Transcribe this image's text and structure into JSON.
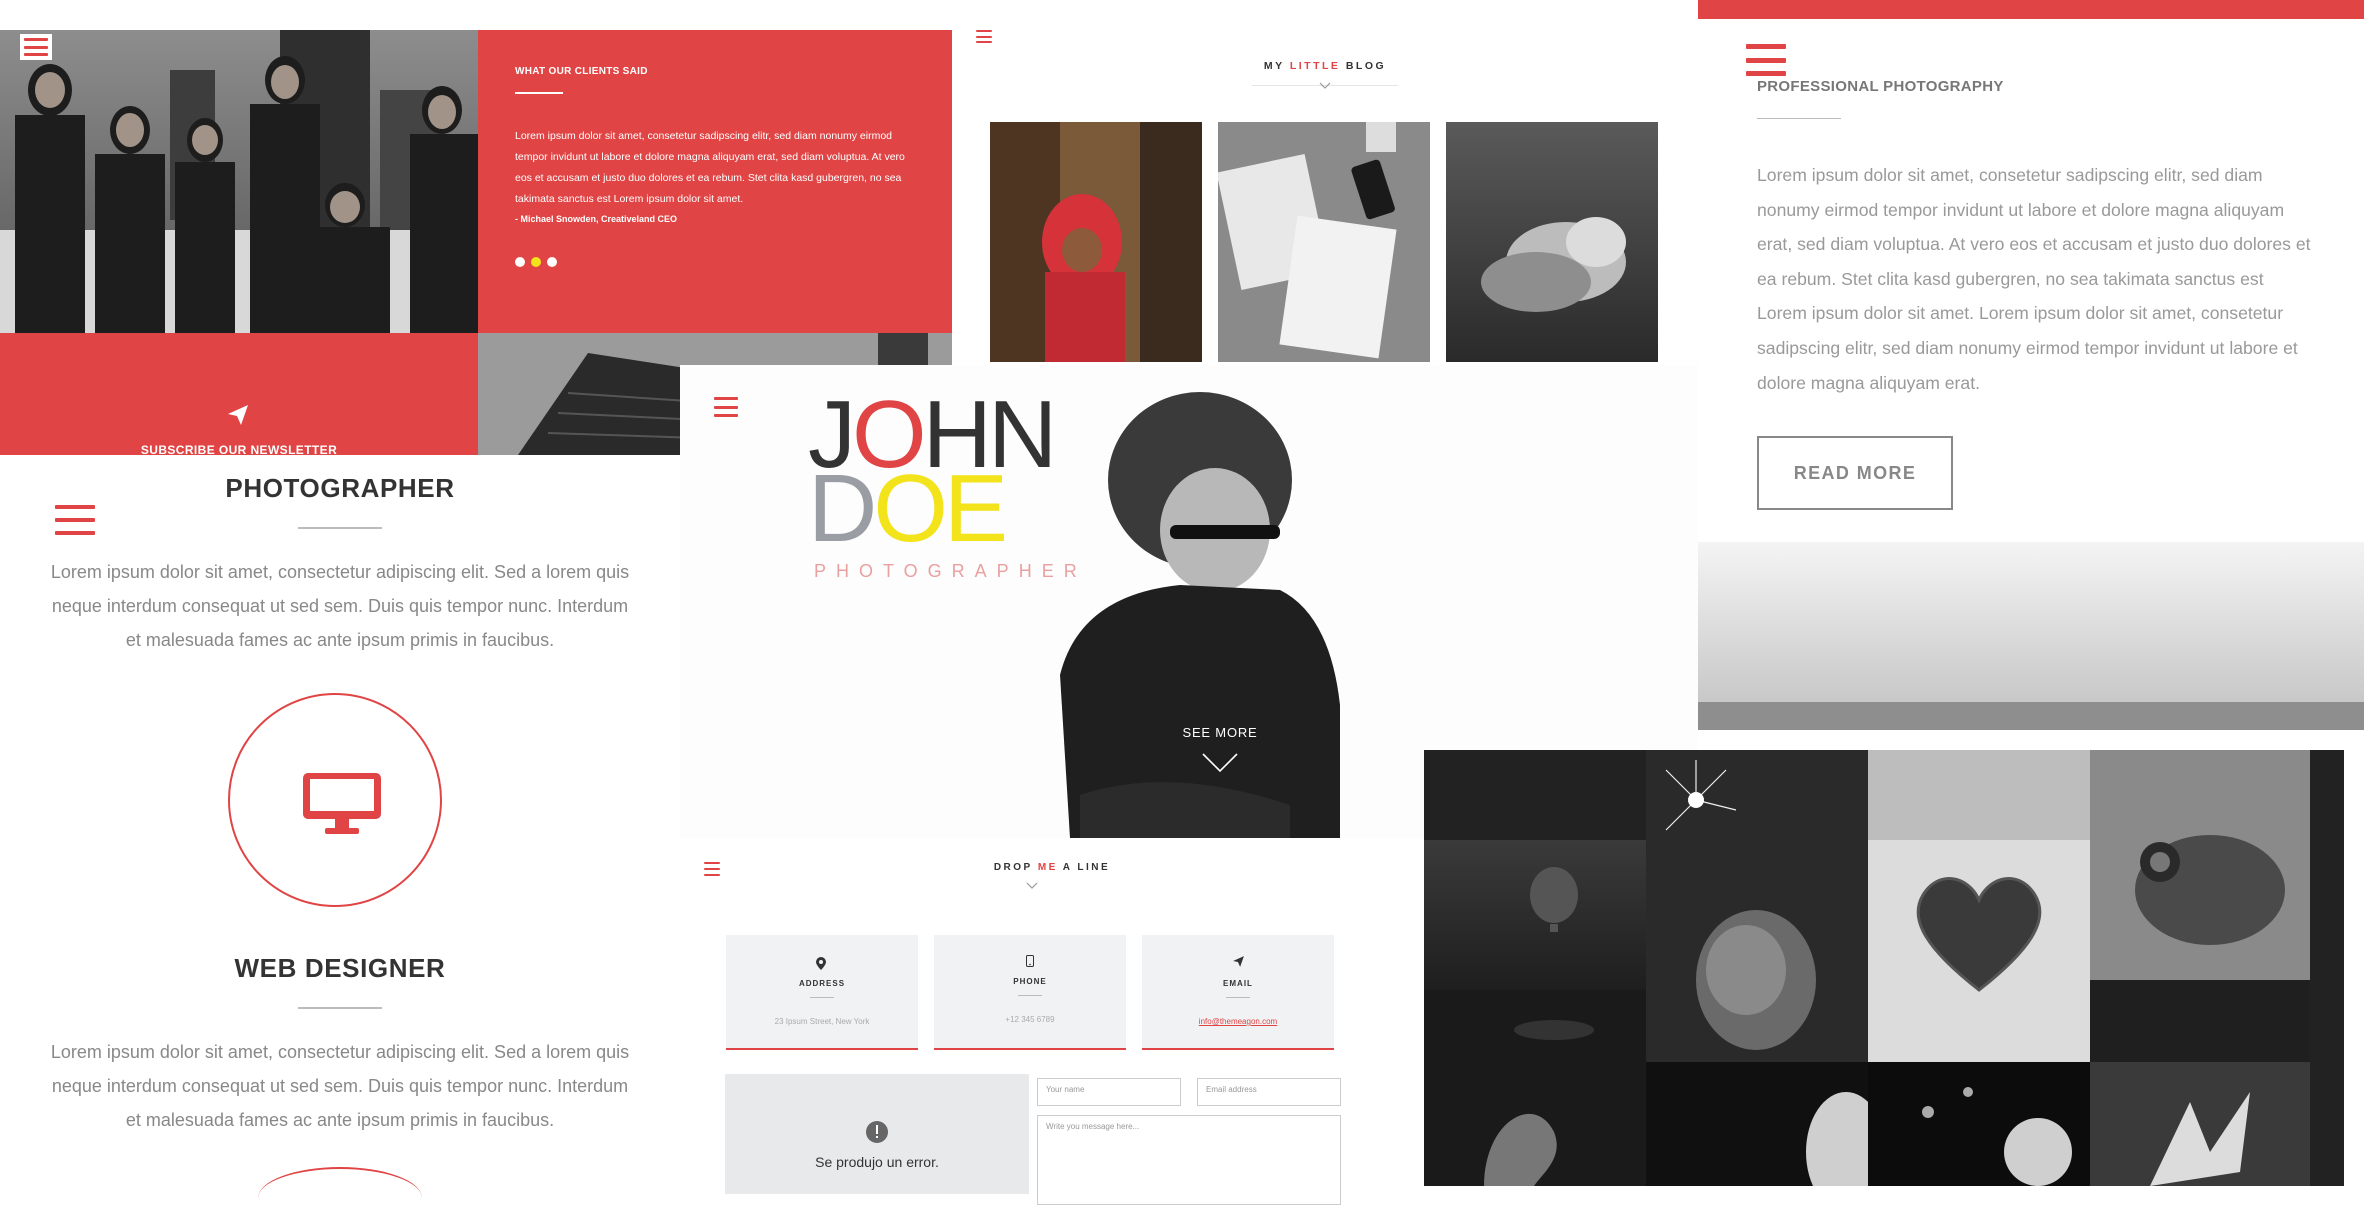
{
  "testimonial": {
    "title": "WHAT OUR CLIENTS SAID",
    "text": "Lorem ipsum dolor sit amet, consetetur sadipscing elitr, sed diam nonumy eirmod tempor invidunt ut labore et dolore magna aliquyam erat, sed diam voluptua. At vero eos et accusam et justo duo dolores et ea rebum. Stet clita kasd gubergren, no sea takimata sanctus est Lorem ipsum dolor sit amet.",
    "author": "- Michael Snowden, Creativeland CEO",
    "newsletter_label": "SUBSCRIBE OUR NEWSLETTER",
    "active_dot": 2
  },
  "blog": {
    "title_pre": "MY ",
    "title_accent": "LITTLE",
    "title_post": " BLOG"
  },
  "pro": {
    "title": "PROFESSIONAL PHOTOGRAPHY",
    "text": "Lorem ipsum dolor sit amet, consetetur sadipscing elitr, sed diam nonumy eirmod tempor invidunt ut labore et dolore magna aliquyam erat, sed diam voluptua. At vero eos et accusam et justo duo dolores et ea rebum. Stet clita kasd gubergren, no sea takimata sanctus est Lorem ipsum dolor sit amet. Lorem ipsum dolor sit amet, consetetur sadipscing elitr, sed diam nonumy eirmod tempor invidunt ut labore et dolore magna aliquyam erat.",
    "button": "READ MORE"
  },
  "roles": [
    {
      "title": "PHOTOGRAPHER",
      "text": "Lorem ipsum dolor sit amet, consectetur adipiscing elit. Sed a lorem quis neque interdum consequat ut sed sem. Duis quis tempor nunc. Interdum et malesuada fames ac ante ipsum primis in faucibus."
    },
    {
      "title": "WEB DESIGNER",
      "text": "Lorem ipsum dolor sit amet, consectetur adipiscing elit. Sed a lorem quis neque interdum consequat ut sed sem. Duis quis tempor nunc. Interdum et malesuada fames ac ante ipsum primis in faucibus."
    }
  ],
  "hero": {
    "name_a1": "J",
    "name_a2": "O",
    "name_a3": "HN",
    "name_b1": "D",
    "name_b2": "OE",
    "subtitle": "PHOTOGRAPHER",
    "see_more": "SEE MORE"
  },
  "contact": {
    "title_pre": "DROP ",
    "title_accent": "ME",
    "title_post": " A LINE",
    "cards": [
      {
        "label": "ADDRESS",
        "value": "23 Ipsum Street, New York"
      },
      {
        "label": "PHONE",
        "value": "+12 345 6789"
      },
      {
        "label": "EMAIL",
        "value": "info@themeagon.com"
      }
    ],
    "map_error": "Se produjo un error.",
    "name_placeholder": "Your name",
    "email_placeholder": "Email address",
    "message_placeholder": "Write you message here..."
  },
  "colors": {
    "accent": "#e04444",
    "yellow": "#f3e31a",
    "gray_text": "#999999"
  },
  "icons": [
    "menu-icon",
    "paper-plane-icon",
    "chevron-down-icon",
    "monitor-icon",
    "location-pin-icon",
    "phone-icon",
    "error-icon"
  ]
}
